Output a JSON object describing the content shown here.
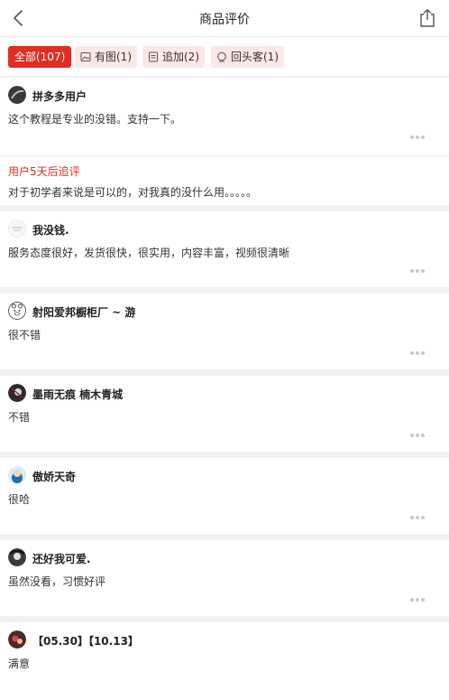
{
  "header": {
    "title": "商品评价",
    "back_icon": "chevron-left-icon",
    "share_icon": "share-icon"
  },
  "filters": [
    {
      "label": "全部(107)",
      "active": true
    },
    {
      "label": "有图(1)",
      "icon": "image-icon"
    },
    {
      "label": "追加(2)",
      "icon": "document-icon"
    },
    {
      "label": "回头客(1)",
      "icon": "returning-customer-icon"
    }
  ],
  "reviews": [
    {
      "user": "拼多多用户",
      "text": "这个教程是专业的没错。支持一下。",
      "followup_label": "用户5天后追评",
      "followup_text": "对于初学者来说是可以的，对我真的没什么用。。。。。"
    },
    {
      "user": "我没钱.",
      "text": "服务态度很好，发货很快，很实用，内容丰富，视频很清晰"
    },
    {
      "user": "射阳爱邦橱柜厂 ~ 游",
      "text": "很不错"
    },
    {
      "user": "墨雨无痕 楠木青城",
      "text": "不错"
    },
    {
      "user": "傲娇天奇",
      "text": "很哈"
    },
    {
      "user": "还好我可爱.",
      "text": "虽然没看，习惯好评"
    },
    {
      "user": "【05.30】【10.13】",
      "text": "满意"
    }
  ],
  "colors": {
    "accent": "#e02e24",
    "chip_bg": "#fbe8e6",
    "page_bg": "#f2f2f2"
  }
}
